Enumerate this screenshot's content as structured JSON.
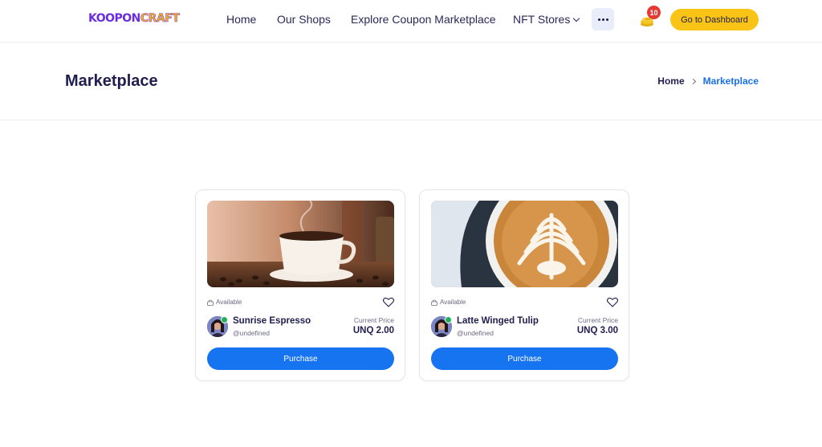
{
  "header": {
    "logo_part1": "KOOPON",
    "logo_part2": "CRAFT",
    "nav": {
      "home": "Home",
      "shops": "Our Shops",
      "explore": "Explore Coupon Marketplace",
      "nft": "NFT Stores"
    },
    "cart_count": "10",
    "dashboard_button": "Go to Dashboard"
  },
  "page": {
    "title": "Marketplace",
    "breadcrumb": {
      "home": "Home",
      "current": "Marketplace"
    }
  },
  "cards": [
    {
      "status": "Available",
      "name": "Sunrise Espresso",
      "owner": "@undefined",
      "price_label": "Current Price",
      "price": "UNQ 2.00",
      "button": "Purchase",
      "image": "espresso-cup-photo"
    },
    {
      "status": "Available",
      "name": "Latte Winged Tulip",
      "owner": "@undefined",
      "price_label": "Current Price",
      "price": "UNQ 3.00",
      "button": "Purchase",
      "image": "latte-art-photo"
    }
  ],
  "colors": {
    "accent": "#1774f0",
    "cta_yellow": "#f9c416",
    "heading": "#1f1d4f",
    "badge_red": "#e53935",
    "verified_green": "#21b05a"
  },
  "icons": [
    "more-icon",
    "cart-icon",
    "chevron-down-icon",
    "chevron-right-icon",
    "lock-icon",
    "heart-icon",
    "verified-icon"
  ]
}
